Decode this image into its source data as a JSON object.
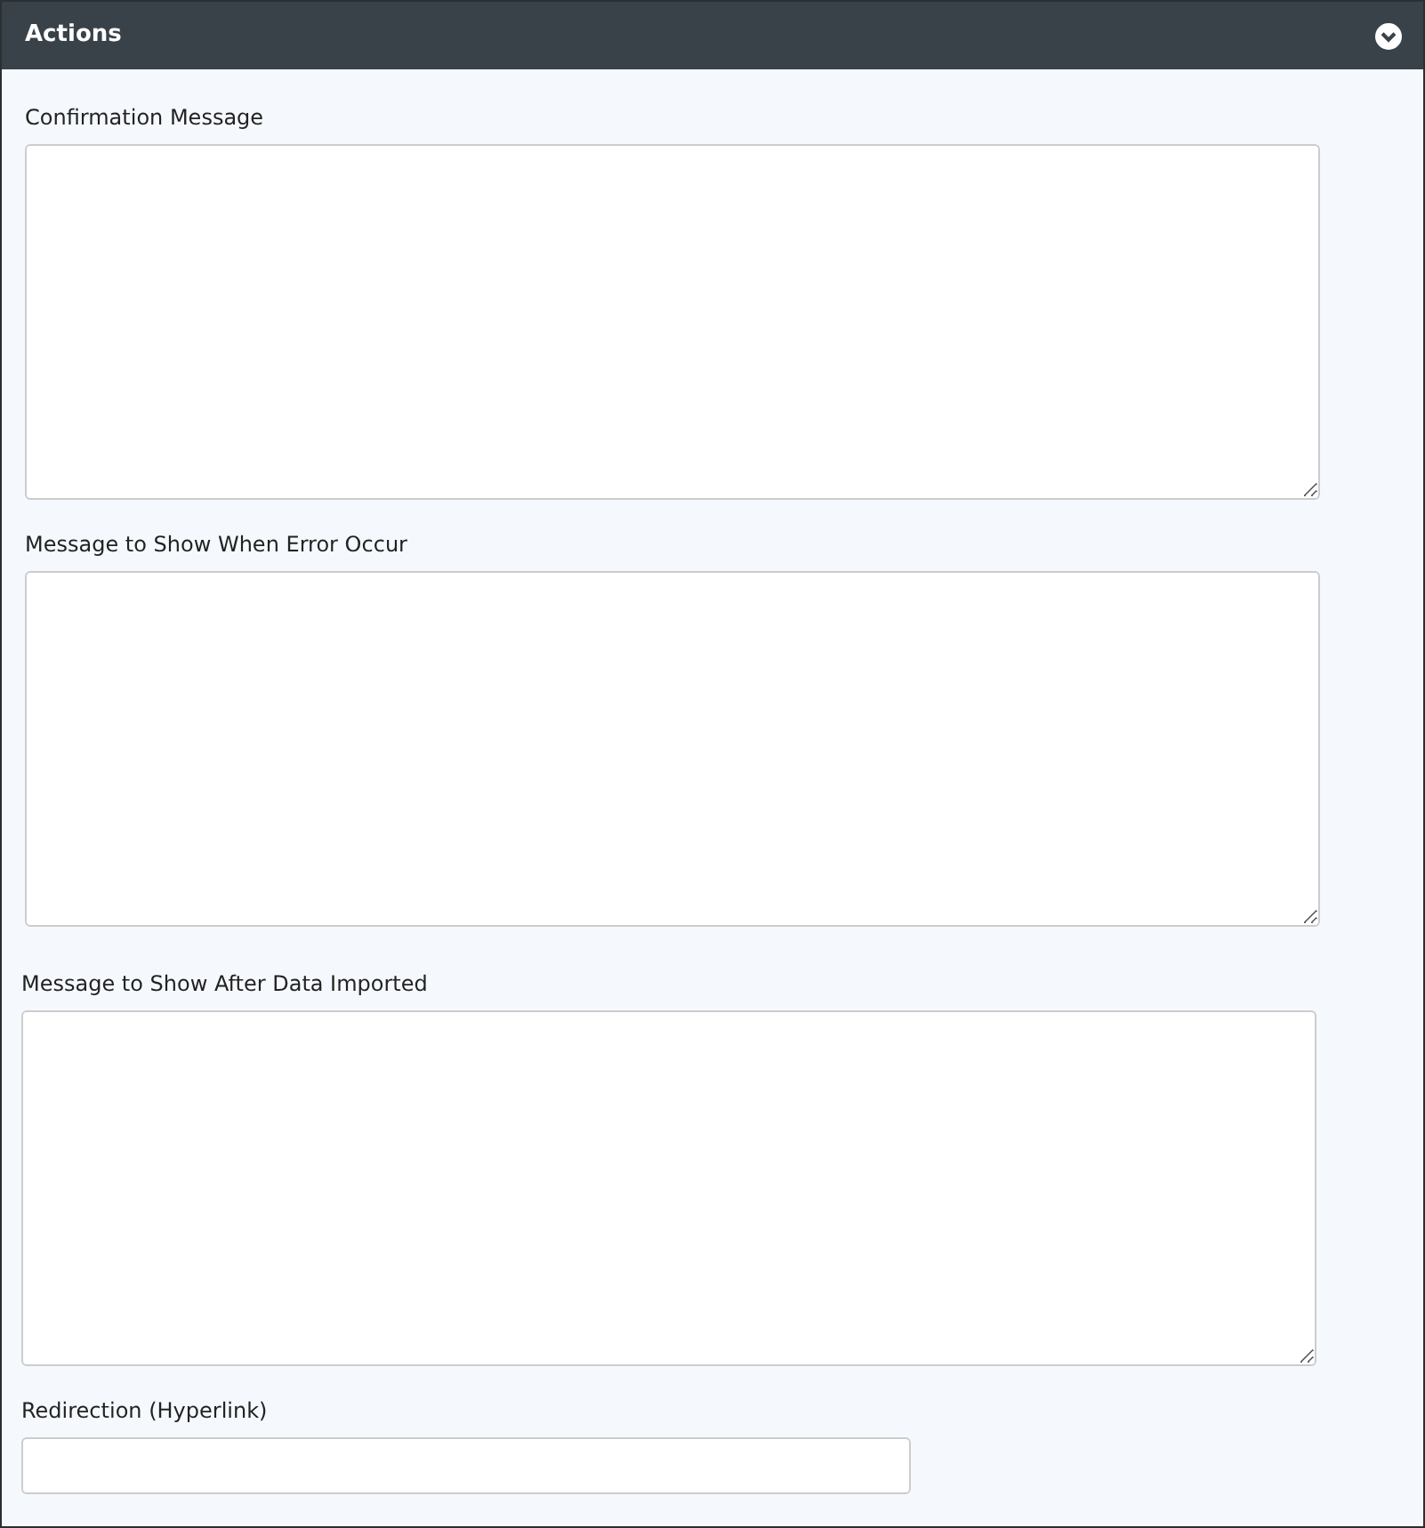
{
  "panel": {
    "title": "Actions",
    "expanded": true
  },
  "fields": [
    {
      "label": "Confirmation Message",
      "kind": "textarea"
    },
    {
      "label": "Message to Show When Error Occur",
      "kind": "textarea"
    },
    {
      "label": "Message to Show After Data Imported",
      "kind": "textarea"
    },
    {
      "label": "Redirection (Hyperlink)",
      "kind": "input"
    }
  ]
}
